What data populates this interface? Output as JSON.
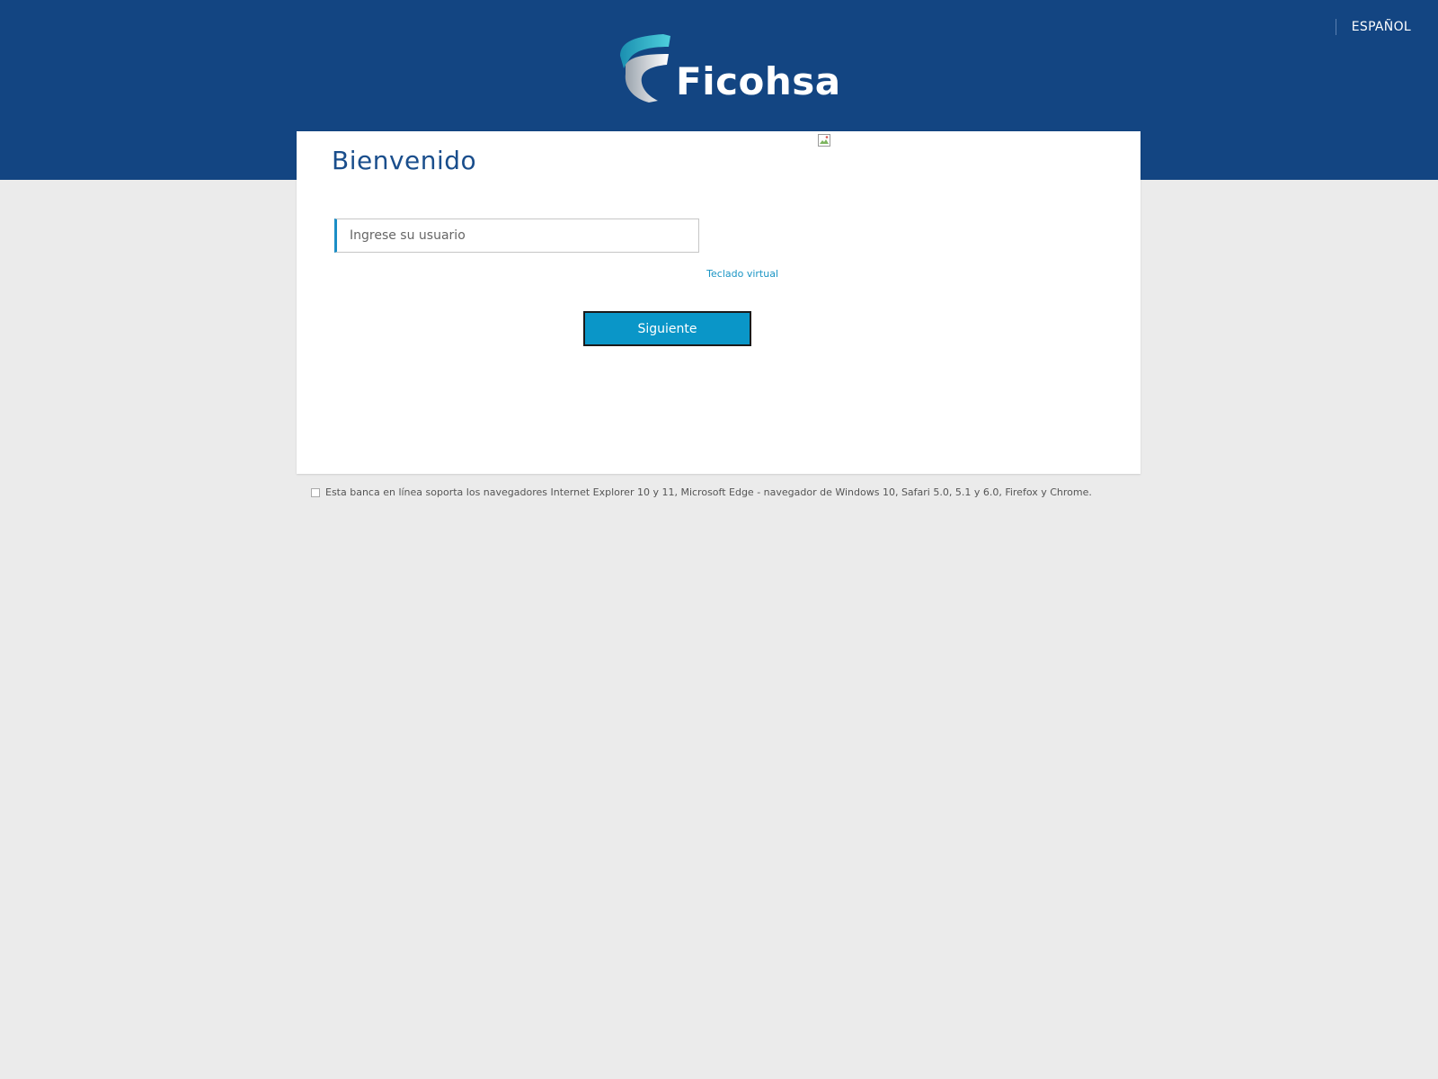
{
  "header": {
    "language_label": "ESPAÑOL",
    "logo_text": "Ficohsa"
  },
  "login": {
    "title": "Bienvenido",
    "username_placeholder": "Ingrese su usuario",
    "username_value": "",
    "virtual_keyboard_link": "Teclado virtual",
    "next_button": "Siguiente"
  },
  "footer": {
    "browser_support_note": "Esta banca en línea soporta los navegadores Internet Explorer 10 y 11, Microsoft Edge - navegador de Windows 10, Safari 5.0, 5.1 y 6.0, Firefox y Chrome."
  },
  "icons": {
    "logo_mark": "ficohsa-ribbon-icon",
    "broken_image": "broken-image-icon",
    "note_icon": "info-square-icon"
  },
  "colors": {
    "brand_blue": "#134582",
    "title_blue": "#1a4e8c",
    "accent_cyan": "#0a96c8",
    "link_cyan": "#1b95c4",
    "background": "#ebebeb"
  }
}
